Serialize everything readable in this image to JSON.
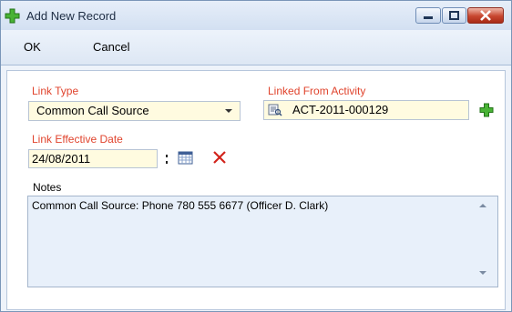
{
  "window": {
    "title": "Add New Record",
    "buttons": {
      "minimize": "minimize",
      "maximize": "maximize",
      "close": "close"
    }
  },
  "menu": {
    "ok_label": "OK",
    "cancel_label": "Cancel"
  },
  "form": {
    "link_type": {
      "label": "Link Type",
      "value": "Common Call Source"
    },
    "linked_from": {
      "label": "Linked From Activity",
      "value": "ACT-2011-000129"
    },
    "effective_date": {
      "label": "Link Effective Date",
      "value": "24/08/2011"
    },
    "notes": {
      "label": "Notes",
      "value": "Common Call Source: Phone 780 555 6677 (Officer D. Clark)"
    }
  },
  "colors": {
    "required_label": "#e0432c",
    "field_bg": "#fffbe0",
    "notes_bg": "#e8f0fa",
    "plus_green": "#3fae2a",
    "clear_red": "#d2231b"
  },
  "icons": [
    "add-record-icon",
    "minimize-icon",
    "maximize-icon",
    "close-icon",
    "lookup-icon",
    "add-icon",
    "dropdown-arrow-icon",
    "spinner-icon",
    "calendar-icon",
    "clear-icon",
    "scroll-up-icon",
    "scroll-down-icon"
  ]
}
